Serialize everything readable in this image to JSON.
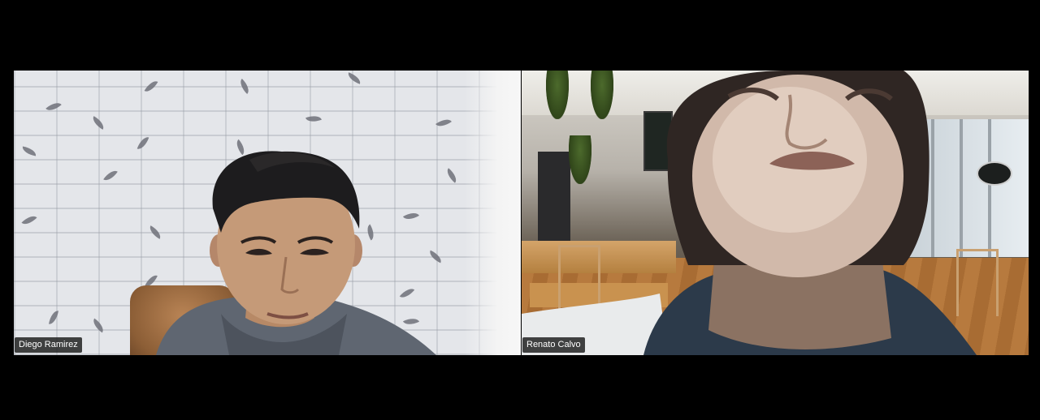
{
  "participants": [
    {
      "name": "Diego Ramirez",
      "background": "brick-wall"
    },
    {
      "name": "Renato Calvo",
      "background": "cafe-interior"
    }
  ],
  "colors": {
    "app_background": "#000000",
    "label_background": "#1a1a1a",
    "label_text": "#ffffff"
  }
}
